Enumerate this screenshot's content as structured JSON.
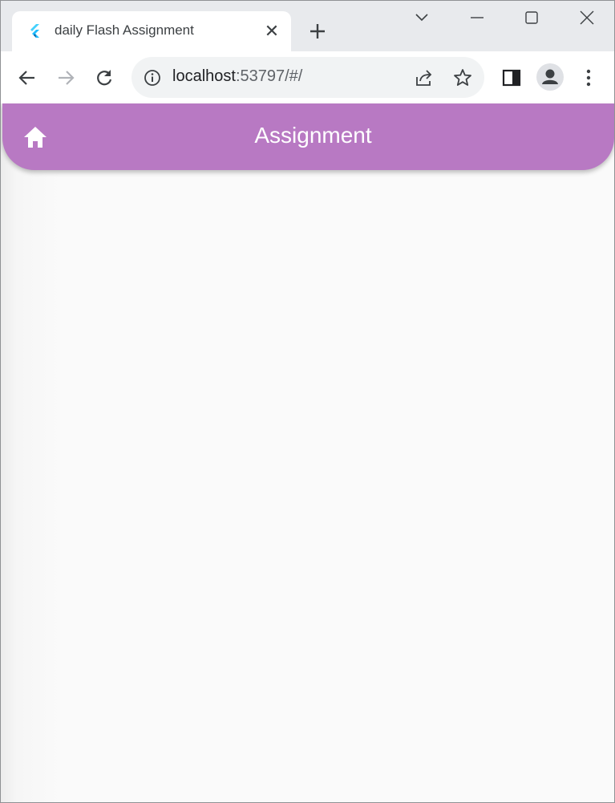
{
  "browser": {
    "tab": {
      "title": "daily Flash Assignment",
      "close_glyph": "✕"
    },
    "address": {
      "host": "localhost",
      "rest": ":53797/#/"
    }
  },
  "app": {
    "title": "Assignment",
    "accent_color": "#b879c3"
  },
  "icons": {
    "favicon": "flutter-icon",
    "home": "home-icon"
  }
}
